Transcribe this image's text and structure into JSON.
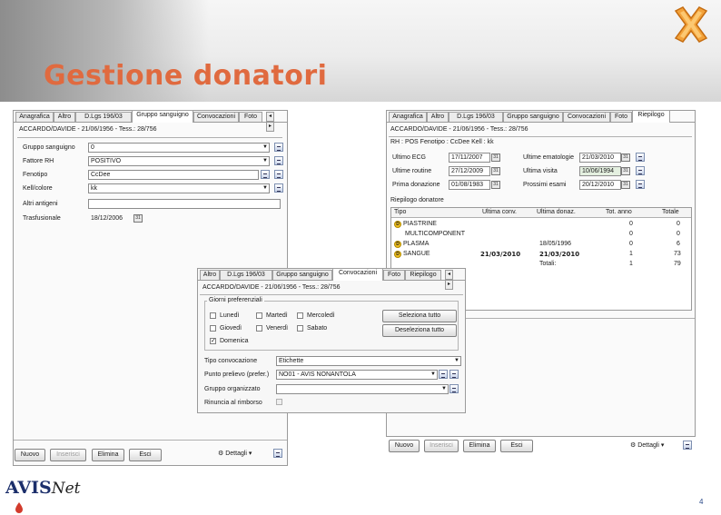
{
  "slide": {
    "title": "Gestione donatori",
    "page_number": "4",
    "logo_text": "AVIS",
    "logo_suffix": "Net",
    "accent": "#e06a3f"
  },
  "w1": {
    "tabs": [
      "Anagrafica",
      "Altro",
      "D.Lgs 196/03",
      "Gruppo sanguigno",
      "Convocazioni",
      "Foto"
    ],
    "active_tab": "Gruppo sanguigno",
    "header": "ACCARDO/DAVIDE - 21/06/1956 - Tess.: 28/756",
    "fields": [
      {
        "label": "Gruppo sanguigno",
        "value": "0"
      },
      {
        "label": "Fattore RH",
        "value": "POSITIVO"
      },
      {
        "label": "Fenotipo",
        "value": "CcDee"
      },
      {
        "label": "Kell/colore",
        "value": "kk"
      },
      {
        "label": "Altri antigeni",
        "value": ""
      },
      {
        "label": "Trasfusionale",
        "value": "18/12/2006"
      }
    ],
    "buttons": {
      "nuovo": "Nuovo",
      "inserisci": "Inserisci",
      "elimina": "Elimina",
      "esci": "Esci",
      "dettagli": "Dettagli"
    }
  },
  "w2": {
    "tabs": [
      "Anagrafica",
      "Altro",
      "D.Lgs 196/03",
      "Gruppo sanguigno",
      "Convocazioni",
      "Foto",
      "Riepilogo"
    ],
    "active_tab": "Riepilogo",
    "header": "ACCARDO/DAVIDE - 21/06/1956 - Tess.: 28/756",
    "rh_line": "RH : POS Fenotipo : CcDee Kell : kk",
    "left_fields": [
      {
        "label": "Ultimo ECG",
        "value": "17/11/2007"
      },
      {
        "label": "Ultime routine",
        "value": "27/12/2009"
      },
      {
        "label": "Prima donazione",
        "value": "01/08/1983"
      }
    ],
    "right_fields": [
      {
        "label": "Ultime ematologie",
        "value": "21/03/2010"
      },
      {
        "label": "Ultima visita",
        "value": "10/06/1994"
      },
      {
        "label": "Prossimi esami",
        "value": "20/12/2010"
      }
    ],
    "summary_label": "Riepilogo donatore",
    "columns": [
      "Tipo",
      "Ultima conv.",
      "Ultima donaz.",
      "Tot. anno",
      "Totale"
    ],
    "rows": [
      {
        "tipo": "PIASTRINE",
        "conv": "",
        "donaz": "",
        "anno": "0",
        "totale": "0",
        "icon": true,
        "bold": false
      },
      {
        "tipo": "MULTICOMPONENT",
        "conv": "",
        "donaz": "",
        "anno": "0",
        "totale": "0",
        "icon": false,
        "bold": false
      },
      {
        "tipo": "PLASMA",
        "conv": "",
        "donaz": "18/05/1996",
        "anno": "0",
        "totale": "6",
        "icon": true,
        "bold": false
      },
      {
        "tipo": "SANGUE",
        "conv": "21/03/2010",
        "donaz": "21/03/2010",
        "anno": "1",
        "totale": "73",
        "icon": true,
        "bold": true
      },
      {
        "tipo": "",
        "conv": "",
        "donaz": "Totali:",
        "anno": "1",
        "totale": "79",
        "icon": false,
        "bold": false
      }
    ],
    "buttons": {
      "nuovo": "Nuovo",
      "inserisci": "Inserisci",
      "elimina": "Elimina",
      "esci": "Esci",
      "dettagli": "Dettagli"
    }
  },
  "w3": {
    "tabs": [
      "Altro",
      "D.Lgs 196/03",
      "Gruppo sanguigno",
      "Convocazioni",
      "Foto",
      "Riepilogo"
    ],
    "active_tab": "Convocazioni",
    "header": "ACCARDO/DAVIDE - 21/06/1956 - Tess.: 28/756",
    "group_label": "Giorni preferenziali",
    "days": [
      {
        "label": "Lunedì",
        "checked": false
      },
      {
        "label": "Martedì",
        "checked": false
      },
      {
        "label": "Mercoledì",
        "checked": false
      },
      {
        "label": "Giovedì",
        "checked": false
      },
      {
        "label": "Venerdì",
        "checked": false
      },
      {
        "label": "Sabato",
        "checked": false
      },
      {
        "label": "Domenica",
        "checked": true
      }
    ],
    "select_all": "Seleziona tutto",
    "deselect_all": "Deseleziona tutto",
    "tipo_label": "Tipo convocazione",
    "tipo_value": "Etichette",
    "punto_label": "Punto prelievo (prefer.)",
    "punto_value": "NO01 - AVIS NONANTOLA",
    "gruppo_label": "Gruppo organizzato",
    "gruppo_value": "",
    "rinuncia_label": "Rinuncia al rimborso"
  }
}
